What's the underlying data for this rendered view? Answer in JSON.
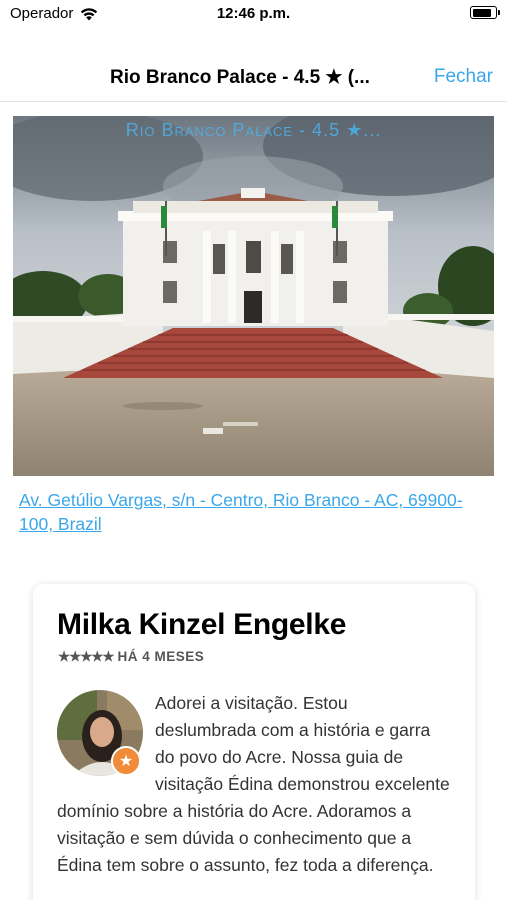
{
  "status_bar": {
    "carrier": "Operador",
    "time": "12:46 p.m.",
    "battery_level": 0.9
  },
  "nav": {
    "title": "Rio Branco Palace - 4.5 ★ (...",
    "close_label": "Fechar"
  },
  "photo": {
    "overlay_title": "Rio Branco Palace - 4.5 ★..."
  },
  "place": {
    "address": "Av. Getúlio Vargas, s/n - Centro, Rio Branco - AC, 69900-100, Brazil"
  },
  "review": {
    "author": "Milka Kinzel Engelke",
    "stars": "★★★★★",
    "time_ago": "HÁ 4 MESES",
    "badge_icon": "star-icon",
    "text": "Adorei a visitação. Estou deslumbrada com a história e garra do povo do Acre. Nossa guia de visitação Édina demonstrou excelente domínio sobre a história do Acre. Adoramos a visitação e sem dúvida o conhecimento que a Édina tem sobre o assunto, fez toda a diferença."
  },
  "colors": {
    "accent": "#3aa7ea",
    "badge": "#f18b3a"
  }
}
